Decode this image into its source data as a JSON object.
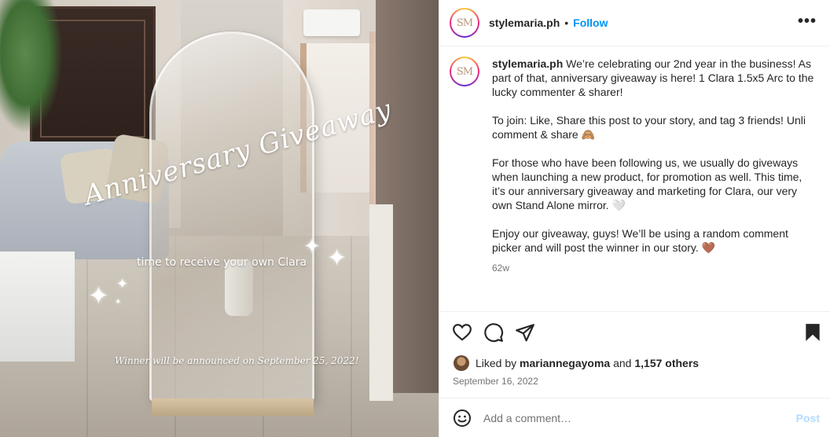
{
  "photo": {
    "title": "Anniversary Giveaway",
    "subtitle": "time to receive your own Clara",
    "winner_note": "Winner will be announced on September 25, 2022!"
  },
  "header": {
    "avatar_monogram": "SM",
    "username": "stylemaria.ph",
    "separator": "•",
    "follow_label": "Follow",
    "more_label": "•••"
  },
  "caption": {
    "avatar_monogram": "SM",
    "username": "stylemaria.ph",
    "paragraph1": "We’re celebrating our 2nd year in the business! As part of that, anniversary giveaway is here! 1 Clara 1.5x5 Arc to the lucky commenter & sharer!",
    "paragraph2": "To join: Like, Share this post to your story, and tag 3 friends! Unli comment & share 🙈",
    "paragraph3": "For those who have been following us, we usually do giveways when launching a new product, for promotion as well. This time, it’s our anniversary giveaway and marketing for Clara, our very own Stand Alone mirror. 🤍",
    "paragraph4": "Enjoy our giveaway, guys! We’ll be using a random comment picker and will post the winner in our story. 🤎",
    "time_ago": "62w"
  },
  "actions": {
    "like_icon": "heart-icon",
    "comment_icon": "comment-icon",
    "share_icon": "send-icon",
    "save_icon": "bookmark-icon"
  },
  "likes": {
    "prefix": "Liked by",
    "user": "mariannegayoma",
    "and": "and",
    "others": "1,157 others"
  },
  "post_date": "September 16, 2022",
  "comment": {
    "placeholder": "Add a comment…",
    "post_label": "Post"
  },
  "colors": {
    "link_blue": "#0095f6",
    "post_disabled": "#b3dbff",
    "secondary_text": "#737373",
    "divider": "#efefef"
  }
}
